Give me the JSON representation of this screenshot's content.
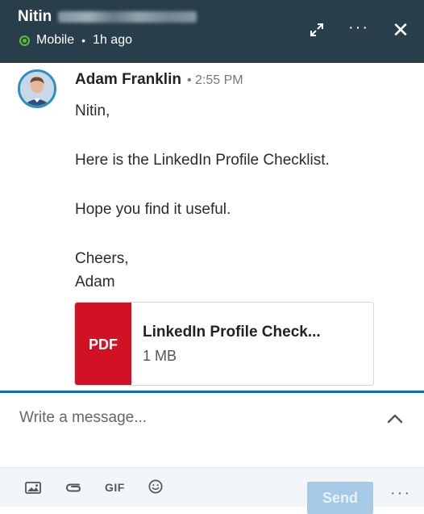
{
  "header": {
    "contact_name": "Nitin",
    "status": "Mobile",
    "last_seen": "1h ago",
    "expand_icon": "expand-arrows-icon",
    "more_icon": "more-horizontal-icon",
    "close_icon": "close-icon"
  },
  "message": {
    "sender": "Adam Franklin",
    "separator": "•",
    "time": "2:55 PM",
    "lines": [
      "Nitin,",
      "Here is the LinkedIn Profile Checklist.",
      "Hope you find it useful.",
      "Cheers,",
      "Adam"
    ]
  },
  "attachment": {
    "type_label": "PDF",
    "name": "LinkedIn Profile Check...",
    "size": "1 MB"
  },
  "composer": {
    "placeholder": "Write a message...",
    "send_label": "Send",
    "gif_label": "GIF",
    "more_label": "···"
  },
  "colors": {
    "header_bg": "#283e4a",
    "accent": "#0073b1",
    "pdf_red": "#d11124",
    "online_green": "#5fbf3a",
    "send_disabled": "#a6c9e6"
  }
}
